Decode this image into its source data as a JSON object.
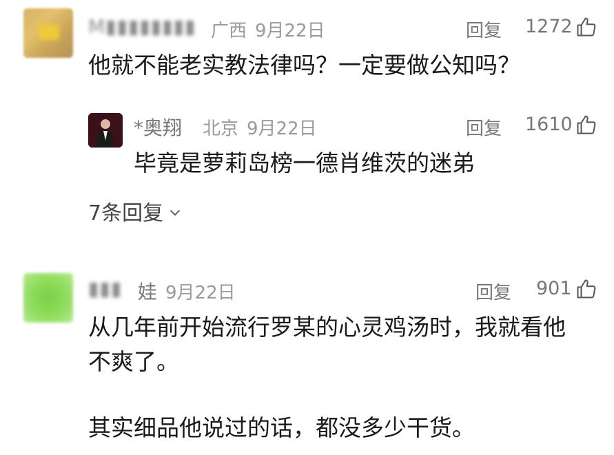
{
  "comments": [
    {
      "user": "M",
      "location": "广西",
      "date": "9月22日",
      "reply_label": "回复",
      "likes": "1272",
      "text": "他就不能老实教法律吗？一定要做公知吗？",
      "replies": [
        {
          "user": "*奥翔",
          "location": "北京",
          "date": "9月22日",
          "reply_label": "回复",
          "likes": "1610",
          "text": "毕竟是萝莉岛榜一德肖维茨的迷弟"
        }
      ],
      "more_replies": "7条回复"
    },
    {
      "user": "娃",
      "date": "9月22日",
      "reply_label": "回复",
      "likes": "901",
      "text_line1": "从几年前开始流行罗某的心灵鸡汤时，我就看他",
      "text_line2": "不爽了。",
      "text_line3": "其实细品他说过的话，都没多少干货。"
    }
  ],
  "icons": {
    "like": "thumbs-up-icon",
    "expand": "chevron-down-icon"
  }
}
